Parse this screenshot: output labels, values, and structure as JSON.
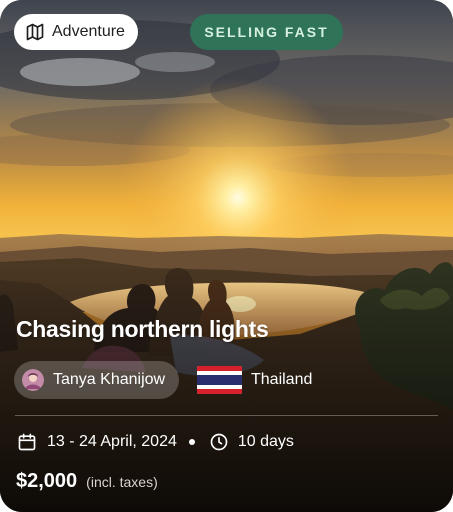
{
  "card": {
    "category": {
      "label": "Adventure",
      "icon": "map-icon"
    },
    "status_badge": "SELLING FAST",
    "title": "Chasing northern lights",
    "author": {
      "name": "Tanya Khanijow",
      "avatar": "avatar-image"
    },
    "country": {
      "name": "Thailand",
      "flag": "thailand-flag-icon"
    },
    "dates": {
      "text": "13 - 24 April, 2024",
      "icon": "calendar-icon"
    },
    "duration": {
      "text": "10 days",
      "icon": "clock-icon"
    },
    "price": {
      "amount": "$2,000",
      "note": "(incl. taxes)"
    }
  },
  "colors": {
    "badge_background": "#2f7458",
    "badge_text": "#d6f0df",
    "chip_background": "#ffffff"
  }
}
